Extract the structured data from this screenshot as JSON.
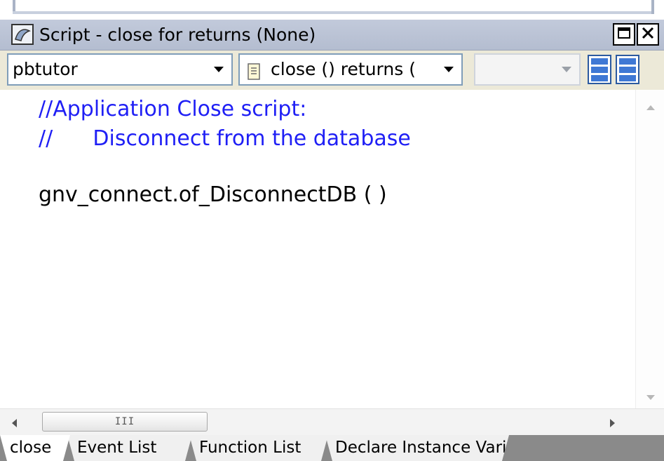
{
  "window": {
    "title": "Script - close for  returns (None)",
    "maximize_icon": "maximize-icon",
    "close_icon": "close-icon"
  },
  "toolbar": {
    "object_dropdown": "pbtutor",
    "event_dropdown": "close () returns (",
    "third_dropdown": ""
  },
  "editor": {
    "lines": [
      "//Application Close script:",
      "//      Disconnect from the database",
      "gnv_connect.of_DisconnectDB ( )"
    ],
    "comment_color": "#1f1ff5",
    "code_color": "#000000"
  },
  "hscroll": {
    "thumb_grip": "III"
  },
  "tabs": [
    {
      "label": "close"
    },
    {
      "label": "Event List"
    },
    {
      "label": "Function List"
    },
    {
      "label": "Declare Instance Variables"
    }
  ]
}
